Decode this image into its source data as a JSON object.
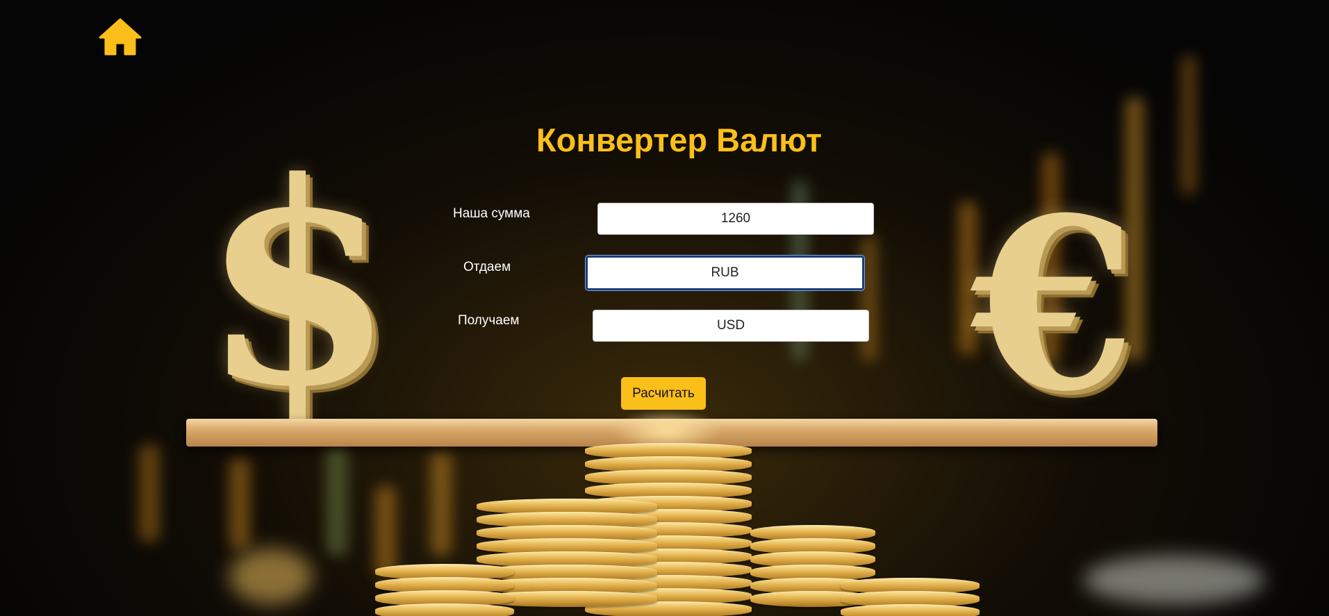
{
  "header": {
    "home_icon": "home-icon"
  },
  "converter": {
    "title": "Конвертер Валют",
    "amount": {
      "label": "Наша сумма",
      "value": "1260"
    },
    "give": {
      "label": "Отдаем",
      "value": "RUB"
    },
    "receive": {
      "label": "Получаем",
      "value": "USD"
    },
    "calculate_label": "Расчитать"
  },
  "colors": {
    "accent": "#fbbf1a",
    "focus_border": "#1a3f78",
    "background": "#050505"
  }
}
